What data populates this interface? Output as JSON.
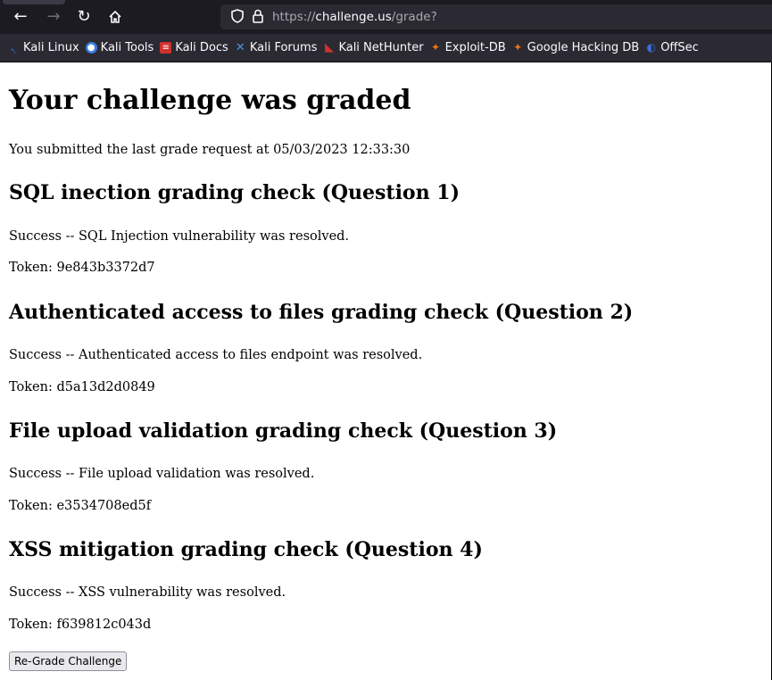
{
  "browser": {
    "url_scheme": "https://",
    "url_host": "challenge.us",
    "url_path": "/grade?",
    "bookmarks": [
      {
        "label": "Kali Linux",
        "icon": "kali-dragon-icon",
        "color": "#367bf0"
      },
      {
        "label": "Kali Tools",
        "icon": "kali-tools-icon",
        "color": "#3a7de0"
      },
      {
        "label": "Kali Docs",
        "icon": "kali-docs-icon",
        "color": "#d0312d"
      },
      {
        "label": "Kali Forums",
        "icon": "kali-forums-icon",
        "color": "#4a90e2"
      },
      {
        "label": "Kali NetHunter",
        "icon": "kali-nethunter-icon",
        "color": "#d0312d"
      },
      {
        "label": "Exploit-DB",
        "icon": "exploit-db-icon",
        "color": "#e8731a"
      },
      {
        "label": "Google Hacking DB",
        "icon": "ghdb-icon",
        "color": "#e8731a"
      },
      {
        "label": "OffSec",
        "icon": "offsec-icon",
        "color": "#3b6fd8"
      }
    ]
  },
  "page": {
    "title": "Your challenge was graded",
    "submitted_text": "You submitted the last grade request at 05/03/2023 12:33:30",
    "checks": [
      {
        "heading": "SQL inection grading check (Question 1)",
        "result": "Success -- SQL Injection vulnerability was resolved.",
        "token": "Token: 9e843b3372d7"
      },
      {
        "heading": "Authenticated access to files grading check (Question 2)",
        "result": "Success -- Authenticated access to files endpoint was resolved.",
        "token": "Token: d5a13d2d0849"
      },
      {
        "heading": "File upload validation grading check (Question 3)",
        "result": "Success -- File upload validation was resolved.",
        "token": "Token: e3534708ed5f"
      },
      {
        "heading": "XSS mitigation grading check (Question 4)",
        "result": "Success -- XSS vulnerability was resolved.",
        "token": "Token: f639812c043d"
      }
    ],
    "regrade_label": "Re-Grade Challenge"
  }
}
